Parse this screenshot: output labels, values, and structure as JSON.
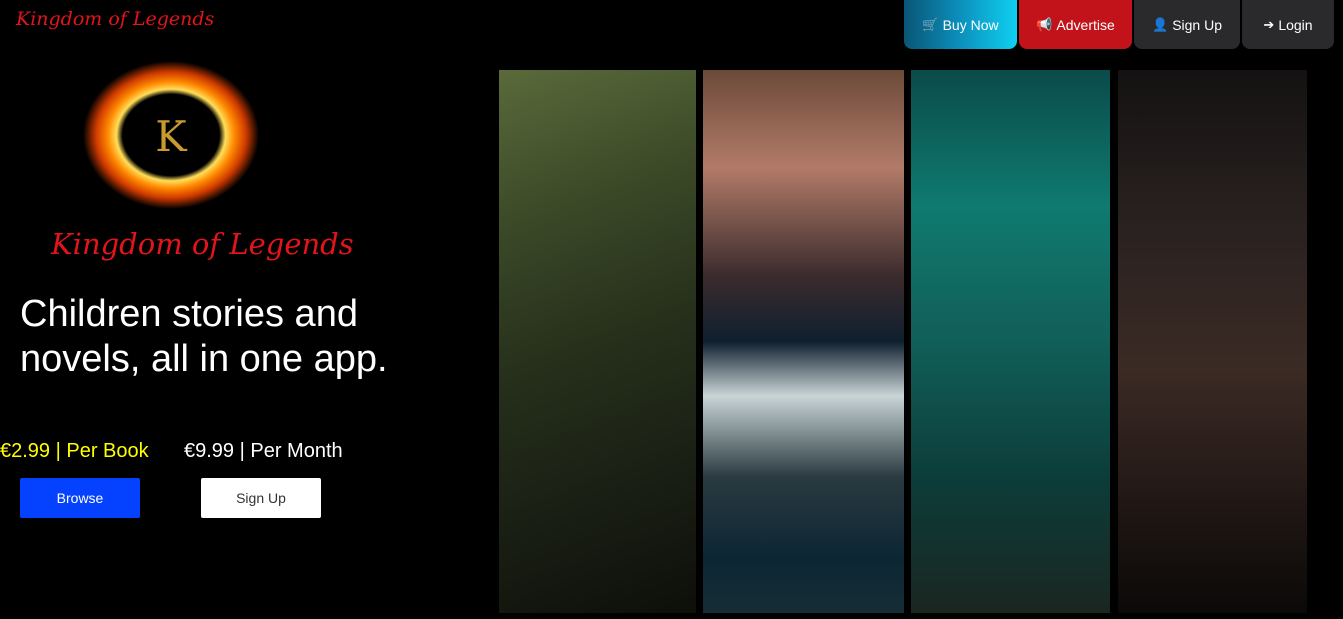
{
  "header": {
    "brand": "Kingdom of Legends",
    "nav": [
      {
        "label": "Buy Now",
        "icon": "cart-icon"
      },
      {
        "label": "Advertise",
        "icon": "megaphone-icon"
      },
      {
        "label": "Sign Up",
        "icon": "user-icon"
      },
      {
        "label": "Login",
        "icon": "login-icon"
      }
    ]
  },
  "hero": {
    "logo_letter": "K",
    "logo_text": "Kingdom of Legends",
    "headline_line1": "Children stories and",
    "headline_line2": "novels, all in one app.",
    "price_book": "€2.99 | Per Book",
    "price_month": "€9.99 | Per Month",
    "browse_label": "Browse",
    "signup_label": "Sign Up"
  },
  "colors": {
    "accent_red": "#e3141a",
    "price_yellow": "#ffff00",
    "browse_blue": "#0542ff"
  }
}
